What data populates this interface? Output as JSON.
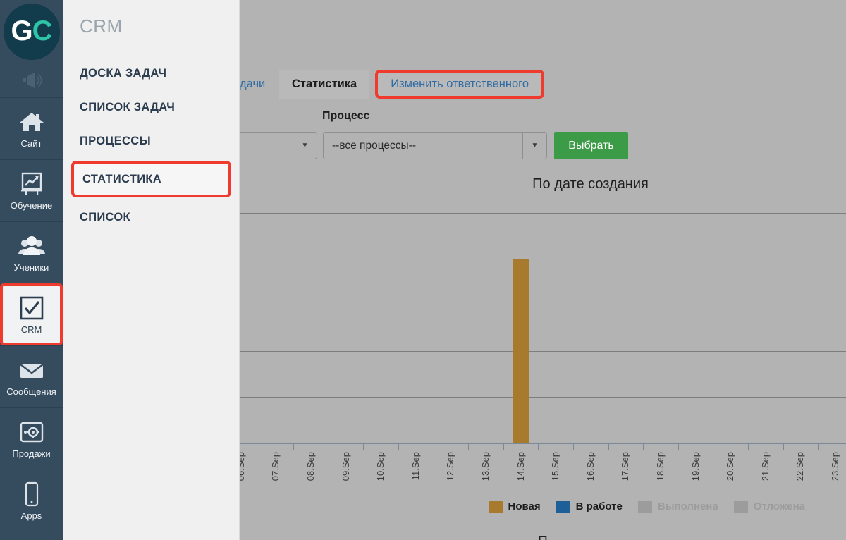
{
  "rail": {
    "logo": {
      "left": "G",
      "right": "C",
      "name": "getcourse-logo"
    },
    "items": [
      {
        "label": "",
        "icon": "megaphone-icon",
        "active": false
      },
      {
        "label": "Сайт",
        "icon": "home-icon",
        "active": false
      },
      {
        "label": "Обучение",
        "icon": "chart-board-icon",
        "active": false
      },
      {
        "label": "Ученики",
        "icon": "people-icon",
        "active": false
      },
      {
        "label": "CRM",
        "icon": "checkbox-check-icon",
        "active": true
      },
      {
        "label": "Сообщения",
        "icon": "envelope-icon",
        "active": false
      },
      {
        "label": "Продажи",
        "icon": "safe-icon",
        "active": false
      },
      {
        "label": "Apps",
        "icon": "phone-icon",
        "active": false
      }
    ]
  },
  "crm_panel": {
    "title": "CRM",
    "items": [
      {
        "label": "ДОСКА ЗАДАЧ",
        "highlighted": false
      },
      {
        "label": "СПИСОК ЗАДАЧ",
        "highlighted": false
      },
      {
        "label": "ПРОЦЕССЫ",
        "highlighted": false
      },
      {
        "label": "СТАТИСТИКА",
        "highlighted": true
      },
      {
        "label": "СПИСОК",
        "highlighted": false
      }
    ]
  },
  "tabs": [
    {
      "label": "дачи",
      "state": "partial"
    },
    {
      "label": "Статистика",
      "state": "active"
    },
    {
      "label": "Изменить ответственного",
      "state": "boxed"
    }
  ],
  "filters": {
    "process_label": "Процесс",
    "left_select_value": "",
    "process_select_value": "--все процессы--",
    "submit_label": "Выбрать"
  },
  "colors": {
    "accent_red": "#ef3b2d",
    "green_button": "#3c9b46",
    "bar_new": "#a87a2e",
    "bar_inwork": "#1f5f97",
    "legend_disabled": "#9c9c9c",
    "rail_bg": "#354b5e",
    "panel_bg": "#f0f0f0",
    "content_bg": "#b3b3b3"
  },
  "bottom_partial_text": "П",
  "chart_data": {
    "type": "bar",
    "title": "По дате создания",
    "xlabel": "",
    "ylabel": "",
    "grid": true,
    "legend_position": "bottom-right",
    "ylim": [
      0,
      5
    ],
    "gridline_values": [
      5,
      4,
      3,
      2,
      1,
      0
    ],
    "categories": [
      "06.Sep",
      "07.Sep",
      "08.Sep",
      "09.Sep",
      "10.Sep",
      "11.Sep",
      "12.Sep",
      "13.Sep",
      "14.Sep",
      "15.Sep",
      "16.Sep",
      "17.Sep",
      "18.Sep",
      "19.Sep",
      "20.Sep",
      "21.Sep",
      "22.Sep",
      "23.Sep"
    ],
    "series": [
      {
        "name": "Новая",
        "color": "#a87a2e",
        "enabled": true,
        "values": [
          0,
          0,
          0,
          0,
          0,
          0,
          0,
          0,
          4,
          0,
          0,
          0,
          0,
          0,
          0,
          0,
          0,
          0
        ]
      },
      {
        "name": "В работе",
        "color": "#1f5f97",
        "enabled": true,
        "values": [
          0,
          0,
          0,
          0,
          0,
          0,
          0,
          0,
          0,
          0,
          0,
          0,
          0,
          0,
          0,
          0,
          0,
          0
        ]
      },
      {
        "name": "Выполнена",
        "color": "#9c9c9c",
        "enabled": false,
        "values": [
          0,
          0,
          0,
          0,
          0,
          0,
          0,
          0,
          0,
          0,
          0,
          0,
          0,
          0,
          0,
          0,
          0,
          0
        ]
      },
      {
        "name": "Отложена",
        "color": "#9c9c9c",
        "enabled": false,
        "values": [
          0,
          0,
          0,
          0,
          0,
          0,
          0,
          0,
          0,
          0,
          0,
          0,
          0,
          0,
          0,
          0,
          0,
          0
        ]
      }
    ]
  }
}
